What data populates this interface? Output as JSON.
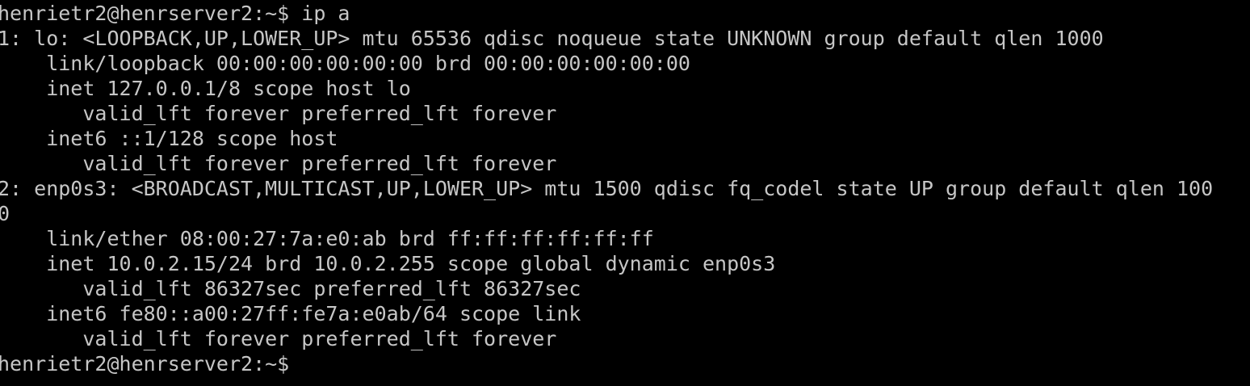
{
  "terminal": {
    "background": "#000000",
    "foreground": "#c6c6c6",
    "lines": [
      "henrietr2@henrserver2:~$ ip a",
      "1: lo: <LOOPBACK,UP,LOWER_UP> mtu 65536 qdisc noqueue state UNKNOWN group default qlen 1000",
      "    link/loopback 00:00:00:00:00:00 brd 00:00:00:00:00:00",
      "    inet 127.0.0.1/8 scope host lo",
      "       valid_lft forever preferred_lft forever",
      "    inet6 ::1/128 scope host",
      "       valid_lft forever preferred_lft forever",
      "2: enp0s3: <BROADCAST,MULTICAST,UP,LOWER_UP> mtu 1500 qdisc fq_codel state UP group default qlen 100",
      "0",
      "    link/ether 08:00:27:7a:e0:ab brd ff:ff:ff:ff:ff:ff",
      "    inet 10.0.2.15/24 brd 10.0.2.255 scope global dynamic enp0s3",
      "       valid_lft 86327sec preferred_lft 86327sec",
      "    inet6 fe80::a00:27ff:fe7a:e0ab/64 scope link",
      "       valid_lft forever preferred_lft forever",
      "henrietr2@henrserver2:~$"
    ]
  }
}
